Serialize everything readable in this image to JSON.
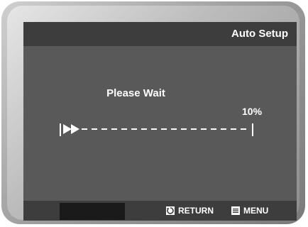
{
  "header": {
    "title": "Auto Setup"
  },
  "status": {
    "message": "Please Wait",
    "progress_label": "10%",
    "progress_fraction": 0.1
  },
  "footer": {
    "return_label": "RETURN",
    "menu_label": "MENU",
    "return_icon": "return-arrow-icon",
    "menu_icon": "menu-icon"
  },
  "colors": {
    "screen_background": "#595959",
    "bar_background": "#3d3d3d",
    "text": "#ffffff"
  }
}
